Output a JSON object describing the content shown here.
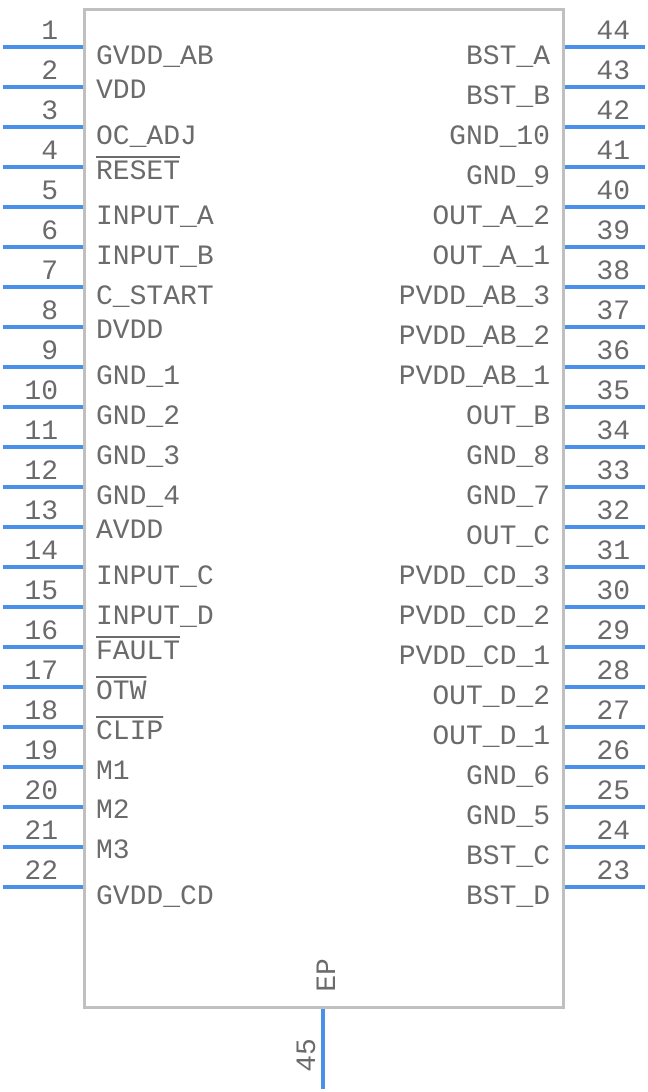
{
  "component": {
    "colors": {
      "pin": "#4a8fe8",
      "outline": "#c0c0c0",
      "text": "#6b6b6b"
    },
    "left_pins": [
      {
        "num": "1",
        "name": "GVDD_AB",
        "active_low": false
      },
      {
        "num": "2",
        "name": "VDD",
        "active_low": false
      },
      {
        "num": "3",
        "name": "OC_ADJ",
        "active_low": false
      },
      {
        "num": "4",
        "name": "RESET",
        "active_low": true
      },
      {
        "num": "5",
        "name": "INPUT_A",
        "active_low": false
      },
      {
        "num": "6",
        "name": "INPUT_B",
        "active_low": false
      },
      {
        "num": "7",
        "name": "C_START",
        "active_low": false
      },
      {
        "num": "8",
        "name": "DVDD",
        "active_low": false
      },
      {
        "num": "9",
        "name": "GND_1",
        "active_low": false
      },
      {
        "num": "10",
        "name": "GND_2",
        "active_low": false
      },
      {
        "num": "11",
        "name": "GND_3",
        "active_low": false
      },
      {
        "num": "12",
        "name": "GND_4",
        "active_low": false
      },
      {
        "num": "13",
        "name": "AVDD",
        "active_low": false
      },
      {
        "num": "14",
        "name": "INPUT_C",
        "active_low": false
      },
      {
        "num": "15",
        "name": "INPUT_D",
        "active_low": false
      },
      {
        "num": "16",
        "name": "FAULT",
        "active_low": true
      },
      {
        "num": "17",
        "name": "OTW",
        "active_low": true
      },
      {
        "num": "18",
        "name": "CLIP",
        "active_low": true
      },
      {
        "num": "19",
        "name": "M1",
        "active_low": false
      },
      {
        "num": "20",
        "name": "M2",
        "active_low": false
      },
      {
        "num": "21",
        "name": "M3",
        "active_low": false
      },
      {
        "num": "22",
        "name": "GVDD_CD",
        "active_low": false
      }
    ],
    "right_pins": [
      {
        "num": "44",
        "name": "BST_A"
      },
      {
        "num": "43",
        "name": "BST_B"
      },
      {
        "num": "42",
        "name": "GND_10"
      },
      {
        "num": "41",
        "name": "GND_9"
      },
      {
        "num": "40",
        "name": "OUT_A_2"
      },
      {
        "num": "39",
        "name": "OUT_A_1"
      },
      {
        "num": "38",
        "name": "PVDD_AB_3"
      },
      {
        "num": "37",
        "name": "PVDD_AB_2"
      },
      {
        "num": "36",
        "name": "PVDD_AB_1"
      },
      {
        "num": "35",
        "name": "OUT_B"
      },
      {
        "num": "34",
        "name": "GND_8"
      },
      {
        "num": "33",
        "name": "GND_7"
      },
      {
        "num": "32",
        "name": "OUT_C"
      },
      {
        "num": "31",
        "name": "PVDD_CD_3"
      },
      {
        "num": "30",
        "name": "PVDD_CD_2"
      },
      {
        "num": "29",
        "name": "PVDD_CD_1"
      },
      {
        "num": "28",
        "name": "OUT_D_2"
      },
      {
        "num": "27",
        "name": "OUT_D_1"
      },
      {
        "num": "26",
        "name": "GND_6"
      },
      {
        "num": "25",
        "name": "GND_5"
      },
      {
        "num": "24",
        "name": "BST_C"
      },
      {
        "num": "23",
        "name": "BST_D"
      }
    ],
    "bottom_pins": [
      {
        "num": "45",
        "name": "EP"
      }
    ]
  }
}
